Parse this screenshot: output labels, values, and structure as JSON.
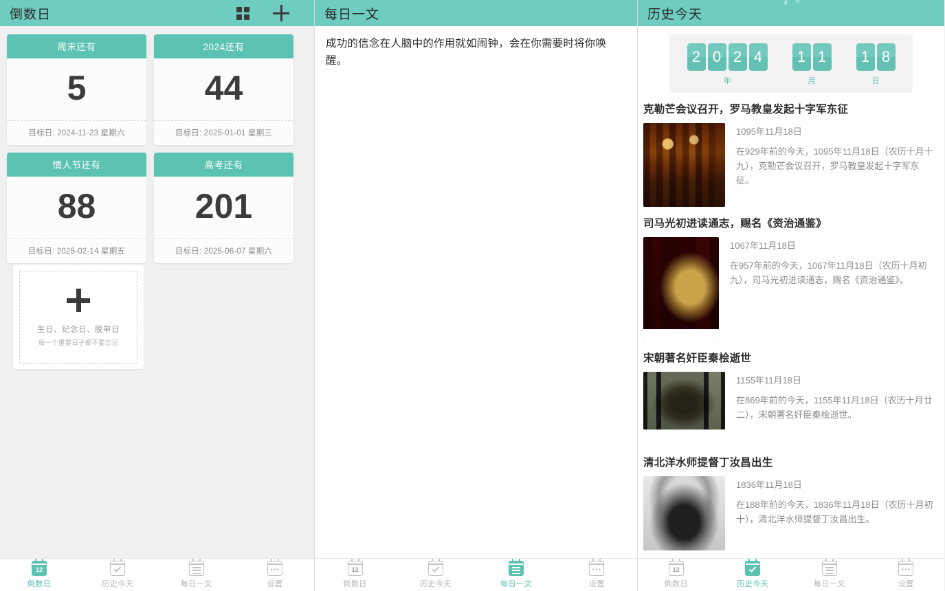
{
  "panel_countdown": {
    "header": {
      "title": "倒数日",
      "grid_icon": "grid-icon",
      "add_icon": "plus-icon"
    },
    "cards": [
      {
        "label": "周末还有",
        "days": "5",
        "target": "目标日: 2024-11-23 星期六"
      },
      {
        "label": "2024还有",
        "days": "44",
        "target": "目标日: 2025-01-01 星期三"
      },
      {
        "label": "情人节还有",
        "days": "88",
        "target": "目标日: 2025-02-14 星期五"
      },
      {
        "label": "高考还有",
        "days": "201",
        "target": "目标日: 2025-06-07 星期六"
      }
    ],
    "add_card": {
      "plus_icon": "plus-icon",
      "line1": "生日、纪念日、脱单日",
      "line2": "每一个重要日子都不要忘记"
    },
    "nav": {
      "active": "倒数日",
      "items": [
        {
          "label": "倒数日",
          "icon": "calendar-12-icon"
        },
        {
          "label": "历史今天",
          "icon": "calendar-check-icon"
        },
        {
          "label": "每日一文",
          "icon": "calendar-lines-icon"
        },
        {
          "label": "设置",
          "icon": "calendar-dots-icon"
        }
      ]
    }
  },
  "panel_article": {
    "header": {
      "title": "每日一文"
    },
    "content": "成功的信念在人脑中的作用就如闹钟，会在你需要时将你唤醒。",
    "nav": {
      "active": "每日一文",
      "items": [
        {
          "label": "倒数日",
          "icon": "calendar-12-icon"
        },
        {
          "label": "历史今天",
          "icon": "calendar-check-icon"
        },
        {
          "label": "每日一文",
          "icon": "calendar-lines-icon"
        },
        {
          "label": "设置",
          "icon": "calendar-dots-icon"
        }
      ]
    }
  },
  "panel_history": {
    "header": {
      "title": "历史今天",
      "spinner": "loading-spinner-icon"
    },
    "date_board": {
      "year_digits": [
        "2",
        "0",
        "2",
        "4"
      ],
      "month_digits": [
        "1",
        "1"
      ],
      "day_digits": [
        "1",
        "8"
      ],
      "year_unit": "年",
      "month_unit": "月",
      "day_unit": "日"
    },
    "events": [
      {
        "title": "克勒芒会议召开，罗马教皇发起十字军东征",
        "date": "1095年11月18日",
        "desc": "在929年前的今天，1095年11月18日（农历十月十九），克勒芒会议召开，罗马教皇发起十字军东征。",
        "thumb": "crusade-council-painting"
      },
      {
        "title": "司马光初进读通志，赐名《资治通鉴》",
        "date": "1067年11月18日",
        "desc": "在957年前的今天，1067年11月18日（农历十月初九），司马光初进读通志，赐名《资治通鉴》。",
        "thumb": "zizhi-tongjian-book"
      },
      {
        "title": "宋朝著名奸臣秦桧逝世",
        "date": "1155年11月18日",
        "desc": "在869年前的今天，1155年11月18日（农历十月廿二），宋朝著名奸臣秦桧逝世。",
        "thumb": "qinhui-statue"
      },
      {
        "title": "清北洋水师提督丁汝昌出生",
        "date": "1836年11月18日",
        "desc": "在188年前的今天，1836年11月18日（农历十月初十），清北洋水师提督丁汝昌出生。",
        "thumb": "dingruchang-portrait"
      }
    ],
    "nav": {
      "active": "历史今天",
      "items": [
        {
          "label": "倒数日",
          "icon": "calendar-12-icon"
        },
        {
          "label": "历史今天",
          "icon": "calendar-check-icon"
        },
        {
          "label": "每日一文",
          "icon": "calendar-lines-icon"
        },
        {
          "label": "设置",
          "icon": "calendar-dots-icon"
        }
      ]
    }
  },
  "colors": {
    "header_teal": "#6fccc0",
    "accent_teal": "#5cc2b1",
    "page_bg": "#f0f0f0",
    "text_dark": "#2c2c2c",
    "text_muted": "#8c8c8c"
  },
  "nav_icon_glyphs": {
    "calendar_12_text": "12",
    "calendar_dots_text": "•••"
  }
}
